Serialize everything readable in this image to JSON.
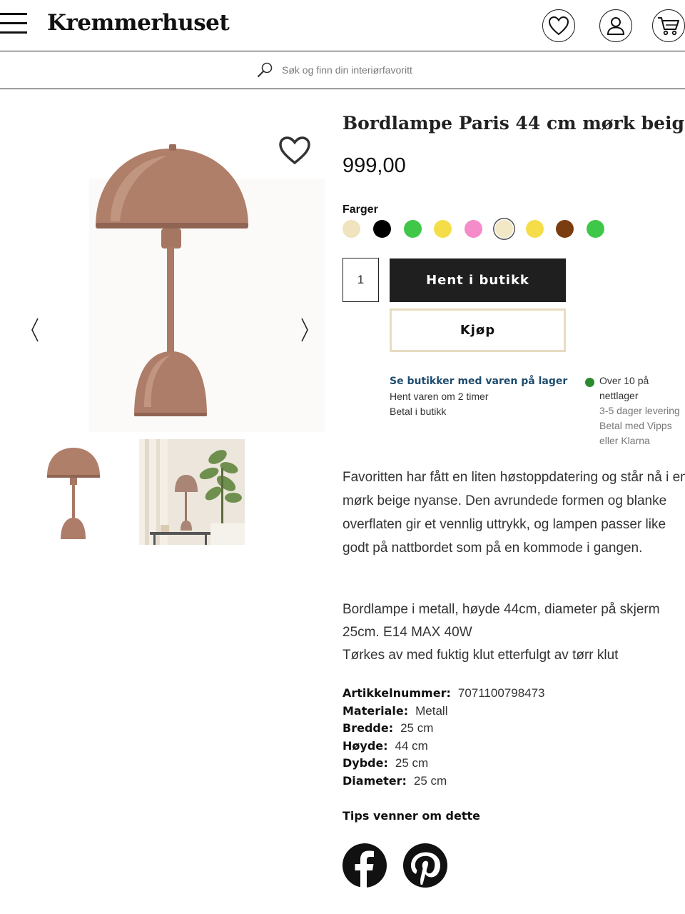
{
  "header": {
    "logo": "Kremmerhuset",
    "icons": [
      "menu-icon",
      "heart-icon",
      "user-icon",
      "cart-icon"
    ]
  },
  "search": {
    "placeholder": "Søk og finn din interiørfavoritt"
  },
  "product": {
    "title": "Bordlampe Paris 44 cm mørk beige",
    "price": "999,00",
    "colors_label": "Farger",
    "swatches": [
      {
        "color": "#efe4bd",
        "selected": false
      },
      {
        "color": "#000000",
        "selected": false
      },
      {
        "color": "#3fc74a",
        "selected": false
      },
      {
        "color": "#f5dd4a",
        "selected": false
      },
      {
        "color": "#f58bc8",
        "selected": false
      },
      {
        "color": "#f2e8c6",
        "selected": true
      },
      {
        "color": "#f5dd4a",
        "selected": false
      },
      {
        "color": "#7a3d0f",
        "selected": false
      },
      {
        "color": "#3fc74a",
        "selected": false
      }
    ],
    "quantity": "1",
    "store_button": "Hent i butikk",
    "buy_button": "Kjøp"
  },
  "availability": {
    "store_link": "Se butikker med varen på lager",
    "store_text": "Hent varen om 2 timer",
    "store_pay": "Betal i butikk",
    "stock_status": "Over 10 på nettlager",
    "delivery": "3-5 dager levering",
    "online_pay": "Betal med Vipps eller Klarna",
    "stock_color": "#2b8a2b"
  },
  "description": {
    "intro": "Favoritten har fått en liten høstoppdatering og står nå i en mørk beige nyanse. Den avrundede formen og blanke overflaten gir et vennlig uttrykk, og lampen passer like godt på nattbordet som på en kommode i gangen.",
    "details_1": "Bordlampe i metall, høyde 44cm, diameter på skjerm 25cm. E14 MAX 40W",
    "details_2": "Tørkes av med fuktig klut etterfulgt av tørr klut"
  },
  "specs": [
    {
      "key": "Artikkelnummer:",
      "value": "7071100798473"
    },
    {
      "key": "Materiale:",
      "value": "Metall"
    },
    {
      "key": "Bredde:",
      "value": "25 cm"
    },
    {
      "key": "Høyde:",
      "value": "44 cm"
    },
    {
      "key": "Dybde:",
      "value": "25 cm"
    },
    {
      "key": "Diameter:",
      "value": "25 cm"
    }
  ],
  "share": {
    "label": "Tips venner om dette",
    "icons": [
      "facebook-icon",
      "pinterest-icon"
    ]
  },
  "colors": {
    "accent_dark": "#1f1f1f",
    "buy_border": "#e8dcc0",
    "lamp": "#b07f6a"
  }
}
